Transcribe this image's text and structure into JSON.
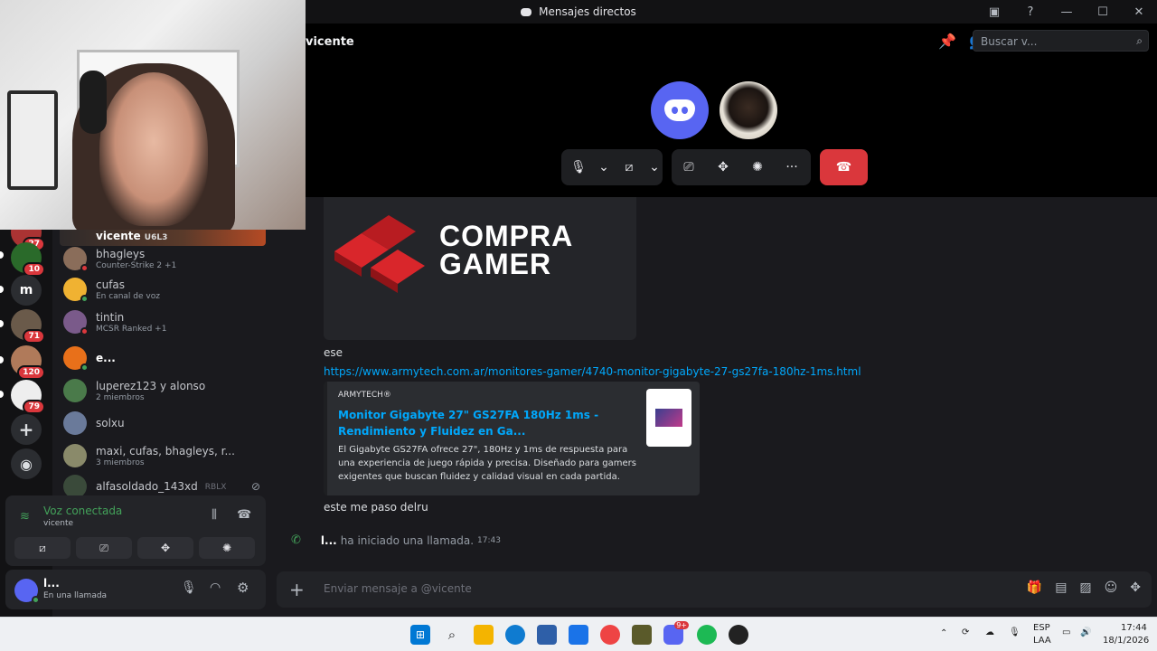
{
  "window": {
    "title": "Mensajes directos"
  },
  "call": {
    "name": "vicente",
    "search_placeholder": "Buscar v..."
  },
  "dm_list": {
    "top_name": "vicente",
    "top_badge": "U6L3",
    "items": [
      {
        "name": "bhagleys",
        "sub": "Counter-Strike 2 +1",
        "color": "#8a6d5a",
        "status": "#da373c"
      },
      {
        "name": "cufas",
        "sub": "En canal de voz",
        "color": "#f0b232",
        "status": "#43a25a"
      },
      {
        "name": "tintin",
        "sub": "MCSR Ranked +1",
        "color": "#7a5a8a",
        "status": "#da373c"
      },
      {
        "name": "e...",
        "sub": "",
        "color": "#e8701a",
        "status": "#43a25a"
      },
      {
        "name": "luperez123 y alonso",
        "sub": "2 miembros",
        "color": "#4a7a4a",
        "status": ""
      },
      {
        "name": "solxu",
        "sub": "",
        "color": "#6a7a9a",
        "status": ""
      },
      {
        "name": "maxi, cufas, bhagleys, r...",
        "sub": "3 miembros",
        "color": "#8a8a6a",
        "status": ""
      },
      {
        "name": "alfasoldado_143xd",
        "sub": "",
        "color": "#3a4a3a",
        "status": "",
        "tag": "RBLX"
      }
    ]
  },
  "servers": [
    {
      "label": "",
      "badge": "27",
      "color": "#a33"
    },
    {
      "label": "",
      "badge": "10",
      "color": "#2a6a2a"
    },
    {
      "label": "m",
      "badge": "",
      "color": "#2b2d31"
    },
    {
      "label": "",
      "badge": "71",
      "color": "#6a5a4a"
    },
    {
      "label": "",
      "badge": "120",
      "color": "#b07a5a"
    },
    {
      "label": "",
      "badge": "79",
      "color": "#eee"
    }
  ],
  "voice": {
    "title": "Voz conectada",
    "sub": "vicente"
  },
  "user": {
    "name": "l...",
    "status": "En una llamada"
  },
  "chat": {
    "logo_line1": "COMPRA",
    "logo_line2": "GAMER",
    "msg1": "ese",
    "link": "https://www.armytech.com.ar/monitores-gamer/4740-monitor-gigabyte-27-gs27fa-180hz-1ms.html",
    "embed_provider": "ARMYTECH®",
    "embed_title": "Monitor Gigabyte 27\" GS27FA 180Hz 1ms - Rendimiento y Fluidez en Ga...",
    "embed_desc": "El Gigabyte GS27FA ofrece 27\", 180Hz y 1ms de respuesta para una experiencia de juego rápida y precisa. Diseñado para gamers exigentes que buscan fluidez y calidad visual en cada partida.",
    "msg2": "este me paso delru",
    "call_user": "l...",
    "call_text": "ha iniciado una llamada.",
    "call_time": "17:43",
    "input_placeholder": "Enviar mensaje a @vicente"
  },
  "taskbar": {
    "lang1": "ESP",
    "lang2": "LAA",
    "time": "17:44",
    "date": "18/1/2026",
    "discord_badge": "9+"
  }
}
